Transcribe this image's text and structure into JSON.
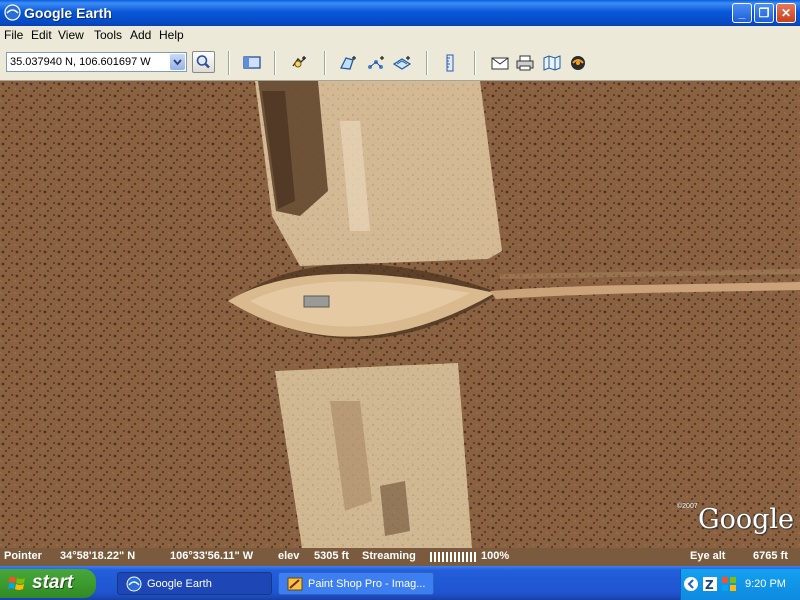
{
  "window": {
    "title": "Google Earth"
  },
  "menu": [
    "File",
    "Edit",
    "View",
    "Tools",
    "Add",
    "Help"
  ],
  "toolbar": {
    "search_value": "35.037940 N, 106.601697 W",
    "icons": [
      "sidebar-toggle-icon",
      "placemark-icon",
      "polygon-icon",
      "path-icon",
      "image-overlay-icon",
      "ruler-icon",
      "email-icon",
      "print-icon",
      "map-icon",
      "sky-icon"
    ]
  },
  "map": {
    "copyright": "©2007",
    "logo": "Google"
  },
  "status": {
    "pointer_label": "Pointer",
    "lat": "34°58'18.22\" N",
    "lon": "106°33'56.11\" W",
    "elev_label": "elev",
    "elev": "5305 ft",
    "streaming_label": "Streaming",
    "streaming_pct": "100%",
    "eye_label": "Eye alt",
    "eye_alt": "6765 ft"
  },
  "taskbar": {
    "start_label": "start",
    "tasks": [
      "Google Earth",
      "Paint Shop Pro - Imag..."
    ],
    "clock": "9:20 PM"
  },
  "colors": {
    "title_blue": "#0a58d8",
    "start_green": "#3c9a2e",
    "taskbar_blue": "#245edb"
  }
}
